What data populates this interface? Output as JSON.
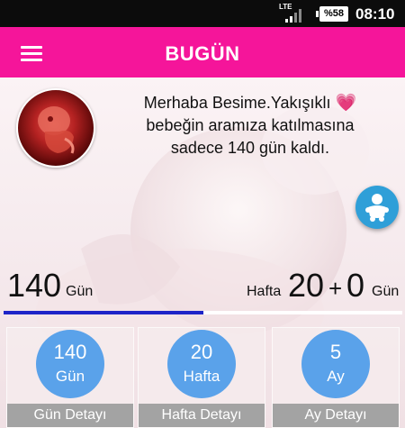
{
  "status_bar": {
    "network": "LTE",
    "battery": "%58",
    "time": "08:10"
  },
  "app_bar": {
    "title": "BUGÜN",
    "menu_icon": "hamburger-menu-icon"
  },
  "greeting": {
    "line1": "Merhaba Besime.Yakışıklı",
    "heart": "💗",
    "line2": "bebeğin aramıza katılmasına",
    "line3": "sadece 140 gün kaldı."
  },
  "summary": {
    "days_value": "140",
    "days_unit": "Gün",
    "week_label": "Hafta",
    "week_value": "20",
    "plus": "+",
    "day_value": "0",
    "day_unit": "Gün",
    "progress_fraction": 0.5
  },
  "cards": [
    {
      "value": "140",
      "unit": "Gün",
      "footer": "Gün Detayı"
    },
    {
      "value": "20",
      "unit": "Hafta",
      "footer": "Hafta Detayı"
    },
    {
      "value": "5",
      "unit": "Ay",
      "footer": "Ay Detayı"
    }
  ],
  "colors": {
    "accent": "#f5159a",
    "progress": "#1e24c8",
    "circle": "#5aa2ea",
    "fab": "#2f9fd8"
  }
}
